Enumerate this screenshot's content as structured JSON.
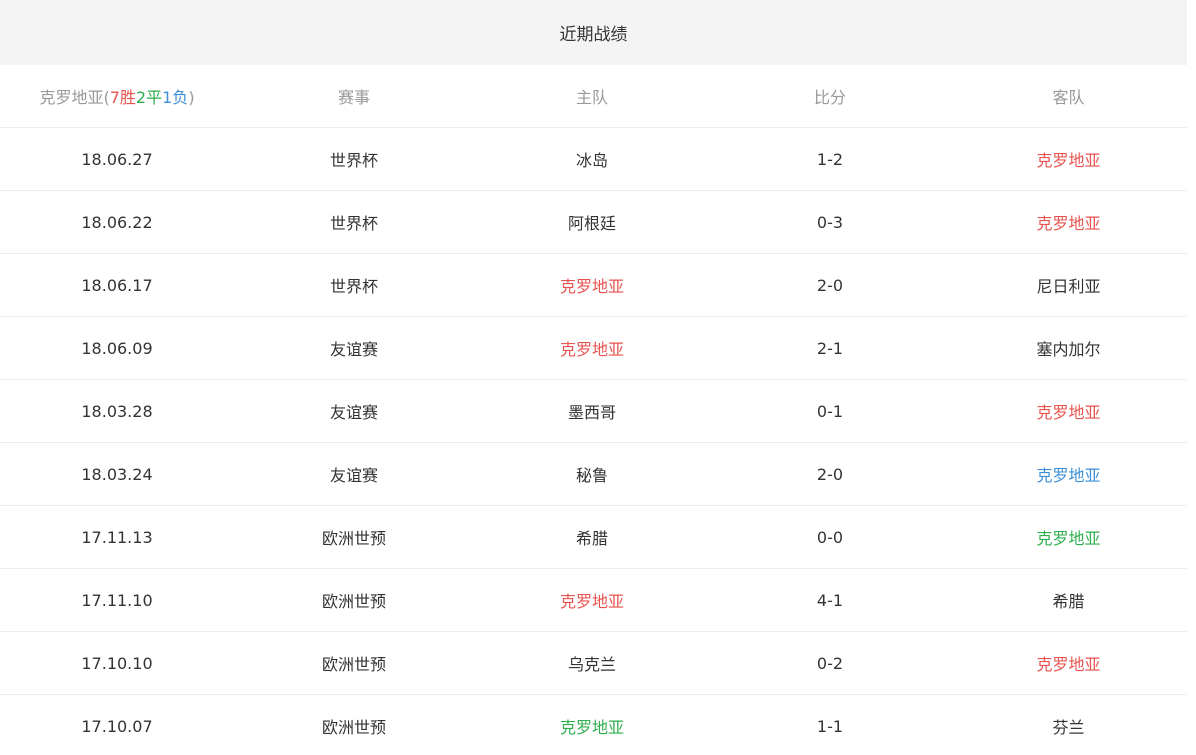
{
  "title": "近期战绩",
  "header": {
    "team": "克罗地亚",
    "paren_open": "(",
    "wins": "7",
    "win_label": "胜",
    "draws": "2",
    "draw_label": "平",
    "losses": "1",
    "loss_label": "负",
    "paren_close": ")",
    "competition": "赛事",
    "home": "主队",
    "score": "比分",
    "away": "客队"
  },
  "rows": [
    {
      "date": "18.06.27",
      "competition": "世界杯",
      "home": "冰岛",
      "home_color": "",
      "score": "1-2",
      "away": "克罗地亚",
      "away_color": "red"
    },
    {
      "date": "18.06.22",
      "competition": "世界杯",
      "home": "阿根廷",
      "home_color": "",
      "score": "0-3",
      "away": "克罗地亚",
      "away_color": "red"
    },
    {
      "date": "18.06.17",
      "competition": "世界杯",
      "home": "克罗地亚",
      "home_color": "red",
      "score": "2-0",
      "away": "尼日利亚",
      "away_color": ""
    },
    {
      "date": "18.06.09",
      "competition": "友谊赛",
      "home": "克罗地亚",
      "home_color": "red",
      "score": "2-1",
      "away": "塞内加尔",
      "away_color": ""
    },
    {
      "date": "18.03.28",
      "competition": "友谊赛",
      "home": "墨西哥",
      "home_color": "",
      "score": "0-1",
      "away": "克罗地亚",
      "away_color": "red"
    },
    {
      "date": "18.03.24",
      "competition": "友谊赛",
      "home": "秘鲁",
      "home_color": "",
      "score": "2-0",
      "away": "克罗地亚",
      "away_color": "blue"
    },
    {
      "date": "17.11.13",
      "competition": "欧洲世预",
      "home": "希腊",
      "home_color": "",
      "score": "0-0",
      "away": "克罗地亚",
      "away_color": "green"
    },
    {
      "date": "17.11.10",
      "competition": "欧洲世预",
      "home": "克罗地亚",
      "home_color": "red",
      "score": "4-1",
      "away": "希腊",
      "away_color": ""
    },
    {
      "date": "17.10.10",
      "competition": "欧洲世预",
      "home": "乌克兰",
      "home_color": "",
      "score": "0-2",
      "away": "克罗地亚",
      "away_color": "red"
    },
    {
      "date": "17.10.07",
      "competition": "欧洲世预",
      "home": "克罗地亚",
      "home_color": "green",
      "score": "1-1",
      "away": "芬兰",
      "away_color": ""
    }
  ],
  "colors": {
    "red": "#e8534f",
    "green": "#2fae4e",
    "blue": "#3d8fd6",
    "text": "#333333",
    "muted": "#999999",
    "header_bg": "#f4f4f4"
  }
}
